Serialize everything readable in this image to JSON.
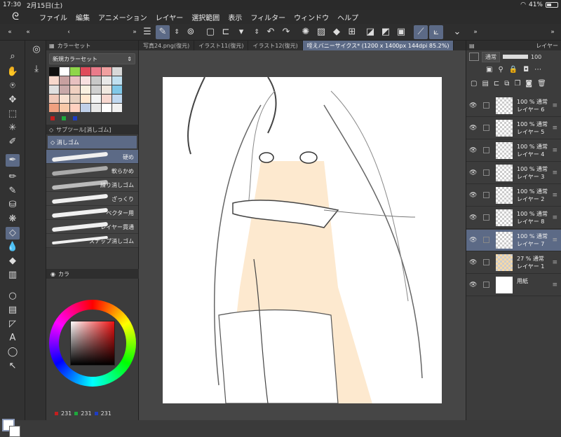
{
  "status": {
    "time": "17:30",
    "date": "2月15日(土)",
    "battery": "41%",
    "battery_level": 0.41
  },
  "menu": {
    "items": [
      "ファイル",
      "編集",
      "アニメーション",
      "レイヤー",
      "選択範囲",
      "表示",
      "フィルター",
      "ウィンドウ",
      "ヘルプ"
    ]
  },
  "colorset": {
    "title": "カラーセット",
    "selected": "新規カラーセット",
    "swatches": [
      "#111111",
      "#ffffff",
      "#8fd64a",
      "#e04a5a",
      "#ea7b8a",
      "#f0a0a0",
      "#d8d8d8",
      "#f7d8cc",
      "#c7a0a0",
      "#e8c0c0",
      "#f8e0e0",
      "#c8c8c8",
      "#e8e8e8",
      "#c0e0f0",
      "#e0e0e0",
      "#c8a8a8",
      "#f0d0c0",
      "#f8f0e0",
      "#d0d0d0",
      "#f0e8e0",
      "#80c8e8",
      "#f0c8b8",
      "#f8e0d0",
      "#e8d0c0",
      "#ffe8d0",
      "#f4f4f4",
      "#f8d8d0",
      "#c0d8f0",
      "#f0a080",
      "#f8c8a8",
      "#ffd0c0",
      "#c0d0e8",
      "#e8e8e8",
      "#ffffff",
      "#f0f0f0"
    ],
    "footer_colors": [
      "#c41e1e",
      "#1ea83c",
      "#1e3cc4"
    ]
  },
  "subtool": {
    "title": "サブツール[消しゴム]",
    "group": "消しゴム",
    "items": [
      "硬め",
      "軟らかめ",
      "練り消しゴム",
      "ざっくり",
      "ベクター用",
      "レイヤー貫通",
      "スナップ消しゴム"
    ]
  },
  "color_panel": {
    "tab": "カラ",
    "r": "231",
    "g": "231",
    "b": "231"
  },
  "tabs": [
    "写真24.png(復元)",
    "イラスト11(復元)",
    "イラスト12(復元)",
    "咥えバニーサイクス* (1200 x 1400px 144dpi 85.2%)"
  ],
  "layers_panel": {
    "title": "レイヤー",
    "blend": "通常",
    "opacity": "100"
  },
  "layers": [
    {
      "percent": "100 %",
      "mode": "通常",
      "name": "レイヤー 6"
    },
    {
      "percent": "100 %",
      "mode": "通常",
      "name": "レイヤー 5"
    },
    {
      "percent": "100 %",
      "mode": "通常",
      "name": "レイヤー 4"
    },
    {
      "percent": "100 %",
      "mode": "通常",
      "name": "レイヤー 3"
    },
    {
      "percent": "100 %",
      "mode": "通常",
      "name": "レイヤー 2"
    },
    {
      "percent": "100 %",
      "mode": "通常",
      "name": "レイヤー 8"
    },
    {
      "percent": "100 %",
      "mode": "通常",
      "name": "レイヤー 7"
    },
    {
      "percent": "27 %",
      "mode": "通常",
      "name": "レイヤー 1"
    },
    {
      "percent": "",
      "mode": "",
      "name": "用紙"
    }
  ]
}
